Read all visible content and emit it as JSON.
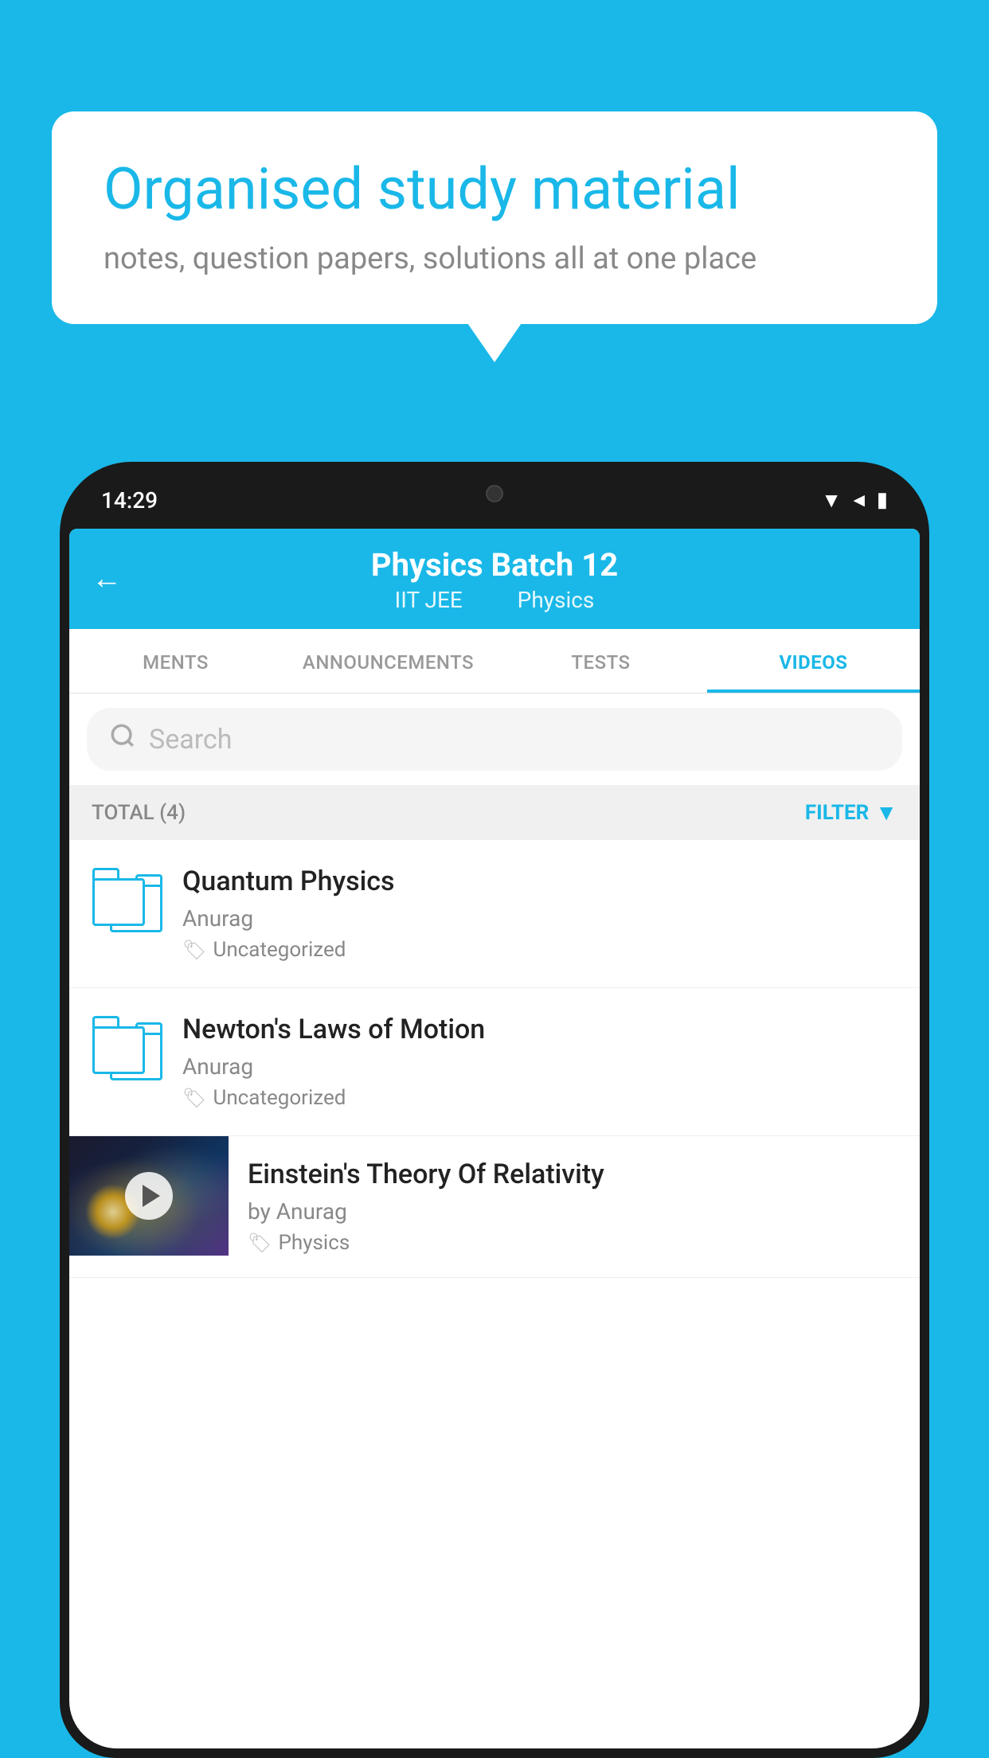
{
  "background": {
    "color": "#1ab8e8"
  },
  "speech_bubble": {
    "title": "Organised study material",
    "subtitle": "notes, question papers, solutions all at one place"
  },
  "phone": {
    "status_bar": {
      "time": "14:29"
    },
    "header": {
      "back_label": "←",
      "title": "Physics Batch 12",
      "subtitle_part1": "IIT JEE",
      "subtitle_part2": "Physics"
    },
    "tabs": [
      {
        "label": "MENTS",
        "active": false
      },
      {
        "label": "ANNOUNCEMENTS",
        "active": false
      },
      {
        "label": "TESTS",
        "active": false
      },
      {
        "label": "VIDEOS",
        "active": true
      }
    ],
    "search": {
      "placeholder": "Search"
    },
    "filter_bar": {
      "total_label": "TOTAL (4)",
      "filter_label": "FILTER"
    },
    "videos": [
      {
        "id": "quantum-physics",
        "title": "Quantum Physics",
        "author": "Anurag",
        "tag": "Uncategorized",
        "has_thumbnail": false
      },
      {
        "id": "newtons-laws",
        "title": "Newton's Laws of Motion",
        "author": "Anurag",
        "tag": "Uncategorized",
        "has_thumbnail": false
      },
      {
        "id": "einstein-relativity",
        "title": "Einstein's Theory Of Relativity",
        "author": "by Anurag",
        "tag": "Physics",
        "has_thumbnail": true
      }
    ]
  }
}
